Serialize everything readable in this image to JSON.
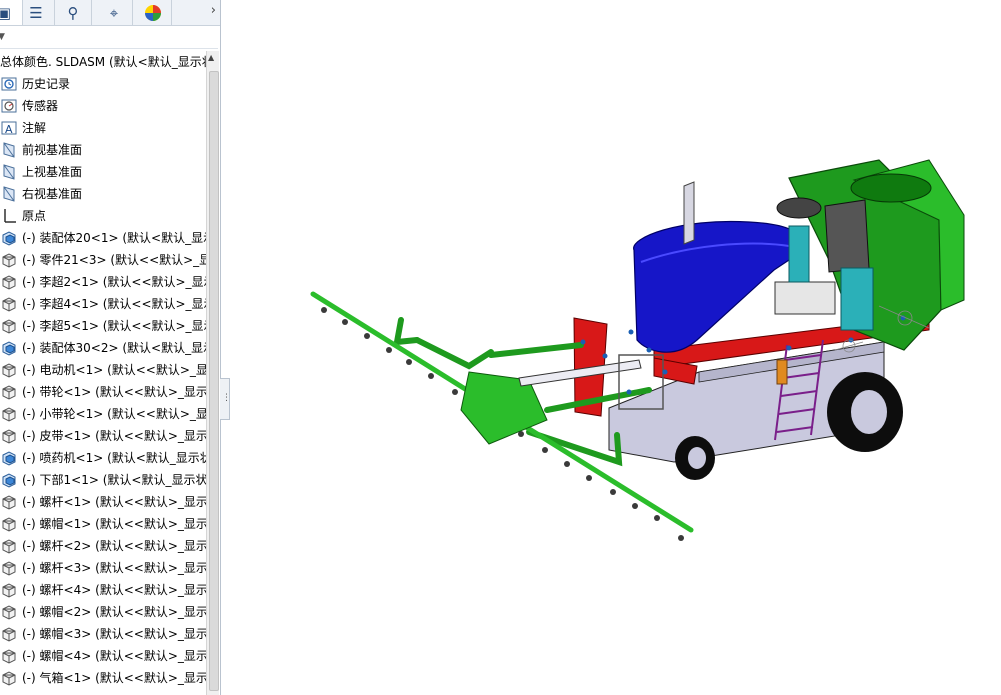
{
  "tabs": [
    {
      "icon": "feature-manager-icon"
    },
    {
      "icon": "property-manager-icon"
    },
    {
      "icon": "configuration-manager-icon"
    },
    {
      "icon": "dimxpert-icon"
    },
    {
      "icon": "display-manager-icon"
    }
  ],
  "tab_more": "›",
  "tree": {
    "root": "总体颜色. SLDASM  (默认<默认_显示状",
    "items": [
      {
        "label": "历史记录",
        "icon": "history-icon"
      },
      {
        "label": "传感器",
        "icon": "sensor-icon"
      },
      {
        "label": "注解",
        "icon": "annotation-icon"
      },
      {
        "label": "前视基准面",
        "icon": "plane-icon"
      },
      {
        "label": "上视基准面",
        "icon": "plane-icon"
      },
      {
        "label": "右视基准面",
        "icon": "plane-icon"
      },
      {
        "label": "原点",
        "icon": "origin-icon"
      },
      {
        "label": "(-) 装配体20<1> (默认<默认_显示",
        "icon": "assembly-icon"
      },
      {
        "label": "(-) 零件21<3> (默认<<默认>_显示",
        "icon": "part-icon"
      },
      {
        "label": "(-) 李超2<1> (默认<<默认>_显示",
        "icon": "part-icon"
      },
      {
        "label": "(-) 李超4<1> (默认<<默认>_显示",
        "icon": "part-icon"
      },
      {
        "label": "(-) 李超5<1> (默认<<默认>_显示",
        "icon": "part-icon"
      },
      {
        "label": "(-) 装配体30<2> (默认<默认_显示",
        "icon": "assembly-icon"
      },
      {
        "label": "(-) 电动机<1> (默认<<默认>_显示",
        "icon": "part-icon"
      },
      {
        "label": "(-) 带轮<1> (默认<<默认>_显示状",
        "icon": "part-icon"
      },
      {
        "label": "(-) 小带轮<1> (默认<<默认>_显示",
        "icon": "part-icon"
      },
      {
        "label": "(-) 皮带<1> (默认<<默认>_显示状",
        "icon": "part-icon"
      },
      {
        "label": "(-) 喷药机<1> (默认<默认_显示状",
        "icon": "assembly-icon"
      },
      {
        "label": "(-) 下部1<1> (默认<默认_显示状态",
        "icon": "assembly-icon"
      },
      {
        "label": "(-) 螺杆<1> (默认<<默认>_显示状",
        "icon": "part-icon"
      },
      {
        "label": "(-) 螺帽<1> (默认<<默认>_显示状",
        "icon": "part-icon"
      },
      {
        "label": "(-) 螺杆<2> (默认<<默认>_显示状",
        "icon": "part-icon"
      },
      {
        "label": "(-) 螺杆<3> (默认<<默认>_显示状",
        "icon": "part-icon"
      },
      {
        "label": "(-) 螺杆<4> (默认<<默认>_显示状",
        "icon": "part-icon"
      },
      {
        "label": "(-) 螺帽<2> (默认<<默认>_显示状",
        "icon": "part-icon"
      },
      {
        "label": "(-) 螺帽<3> (默认<<默认>_显示状",
        "icon": "part-icon"
      },
      {
        "label": "(-) 螺帽<4> (默认<<默认>_显示状",
        "icon": "part-icon"
      },
      {
        "label": "(-) 气箱<1> (默认<<默认>_显示状",
        "icon": "part-icon"
      }
    ]
  },
  "colors": {
    "frame_green": "#1e9a1e",
    "boom_green": "#2bbd2b",
    "hood_blue": "#1616c8",
    "frame_red": "#d81818",
    "body_gray": "#c9c9de",
    "ladder_purple": "#7a1f8a",
    "tank_cyan": "#2bb0b8",
    "select_blue": "#1a5fb4"
  }
}
